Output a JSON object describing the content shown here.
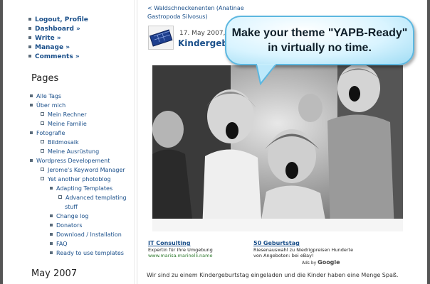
{
  "admin_menu": [
    {
      "label": "Logout, Profile"
    },
    {
      "label": "Dashboard »"
    },
    {
      "label": "Write »"
    },
    {
      "label": "Manage »"
    },
    {
      "label": "Comments »"
    }
  ],
  "pages_heading": "Pages",
  "pages": [
    {
      "label": "Alle Tags"
    },
    {
      "label": "Über mich"
    },
    {
      "label": "Mein Rechner"
    },
    {
      "label": "Meine Familie"
    },
    {
      "label": "Fotografie"
    },
    {
      "label": "Bildmosaik"
    },
    {
      "label": "Meine Ausrüstung"
    },
    {
      "label": "Wordpress Developement"
    },
    {
      "label": "Jerome's Keyword Manager"
    },
    {
      "label": "Yet another photoblog"
    },
    {
      "label": "Adapting Templates"
    },
    {
      "label": "Advanced templating"
    },
    {
      "label": "stuff"
    },
    {
      "label": "Change log"
    },
    {
      "label": "Donators"
    },
    {
      "label": "Download / Installation"
    },
    {
      "label": "FAQ"
    },
    {
      "label": "Ready to use templates"
    }
  ],
  "archive_heading": "May 2007",
  "post": {
    "breadcrumb": "< Waldschneckenenten (Anatinae Gastropoda Silvosus)",
    "date": "17. May 2007, ...",
    "title": "Kindergebu...",
    "body": "Wir sind zu einem Kindergeburtstag eingeladen und die Kinder haben eine Menge Spaß."
  },
  "ads": {
    "ad1": {
      "title": "IT Consulting",
      "text": "Expertin für Ihre Umgebung",
      "url": "www.marisa.marinelli.name"
    },
    "ad2": {
      "title": "50 Geburtstag",
      "text": "Riesenauswahl zu Niedrigpreisen Hunderte von Angeboten: bei eBay!"
    },
    "ads_by": "Ads by",
    "ads_by_brand": "Google"
  },
  "callout": {
    "text": "Make your theme \"YAPB-Ready\" in virtually no time."
  },
  "colors": {
    "link": "#1a4f8a",
    "callout_fill": "#d9f4ff",
    "callout_border": "#5cb7e0"
  }
}
